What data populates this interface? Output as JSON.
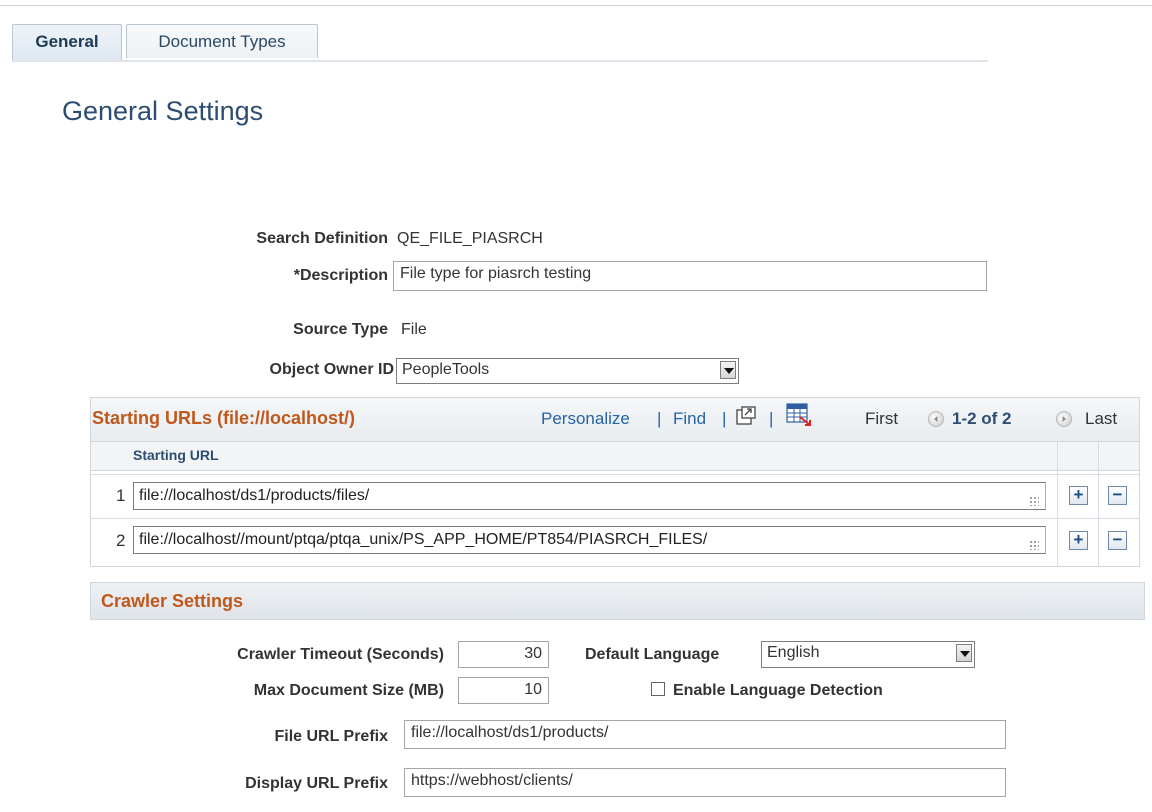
{
  "tabs": [
    {
      "label": "General"
    },
    {
      "label": "Document Types"
    }
  ],
  "page": {
    "title": "General Settings"
  },
  "form": {
    "search_definition": {
      "label": "Search Definition",
      "value": "QE_FILE_PIASRCH"
    },
    "description": {
      "label": "*Description",
      "value": "File type for piasrch testing"
    },
    "source_type": {
      "label": "Source Type",
      "value": "File"
    },
    "object_owner": {
      "label": "Object Owner ID",
      "value": "PeopleTools"
    }
  },
  "grid": {
    "title": "Starting URLs (file://localhost/)",
    "personalize": "Personalize",
    "find": "Find",
    "sep": "|",
    "first": "First",
    "range": "1-2 of 2",
    "last": "Last",
    "column": "Starting URL",
    "rows": [
      {
        "num": "1",
        "url": "file://localhost/ds1/products/files/"
      },
      {
        "num": "2",
        "url": "file://localhost//mount/ptqa/ptqa_unix/PS_APP_HOME/PT854/PIASRCH_FILES/"
      }
    ]
  },
  "crawler": {
    "title": "Crawler Settings",
    "timeout": {
      "label": "Crawler Timeout (Seconds)",
      "value": "30"
    },
    "max_doc": {
      "label": "Max Document Size (MB)",
      "value": "10"
    },
    "default_language": {
      "label": "Default Language",
      "value": "English"
    },
    "lang_detect": {
      "label": "Enable Language Detection",
      "checked": false
    },
    "file_url_prefix": {
      "label": "File URL Prefix",
      "value": "file://localhost/ds1/products/"
    },
    "display_url_prefix": {
      "label": "Display URL Prefix",
      "value": "https://webhost/clients/"
    }
  },
  "colors": {
    "section_title": "#c0581c",
    "link": "#2563a6",
    "page_title": "#2c4d72"
  },
  "icons": [
    "download-icon",
    "grid-export-icon",
    "previous-icon",
    "next-icon",
    "add-row-icon",
    "delete-row-icon",
    "dropdown-arrow-icon"
  ]
}
